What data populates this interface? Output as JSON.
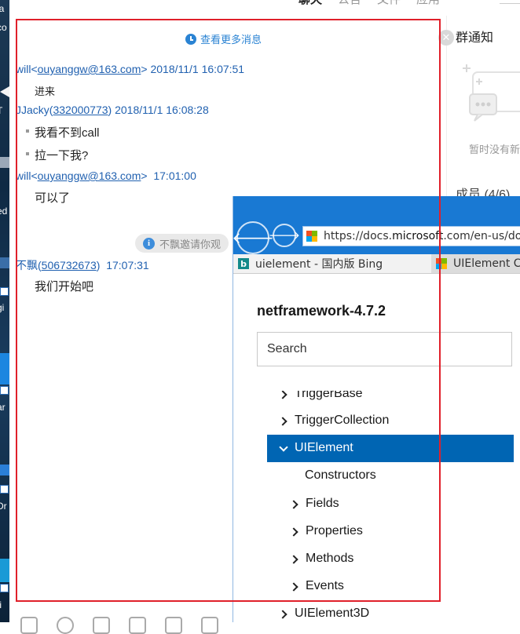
{
  "top_tabs": [
    "聊天",
    "公告",
    "文件",
    "应用"
  ],
  "chat": {
    "more_messages": "查看更多消息",
    "messages": [
      {
        "sender": "will",
        "contact": "ouyanggw@163.com",
        "time": "2018/11/1 16:07:51",
        "lines": [
          "进来"
        ]
      },
      {
        "sender": "JJacky",
        "contact": "332000773",
        "time": "2018/11/1 16:08:28",
        "lines": [
          "我看不到call",
          "拉一下我?"
        ]
      },
      {
        "sender": "will",
        "contact": "ouyanggw@163.com",
        "time": "17:01:00",
        "lines": [
          "可以了"
        ]
      },
      {
        "sender": "不飘",
        "contact": "506732673",
        "time": "17:07:31",
        "lines": [
          "我们开始吧"
        ]
      }
    ],
    "system_notice": "不飘邀请你观"
  },
  "right_panel": {
    "title": "群通知",
    "empty_text": "暂时没有新",
    "members": "成员 (4/6)"
  },
  "browser": {
    "url_prefix": "https://docs.",
    "url_domain": "microsoft",
    "url_suffix": ".com/en-us/do",
    "tabs": [
      "uielement - 国内版 Bing",
      "UIElement C"
    ],
    "doc_title": "netframework-4.7.2",
    "search_placeholder": "Search",
    "toc": [
      {
        "label": "TriggerBase",
        "expanded": false,
        "selected": false
      },
      {
        "label": "TriggerCollection",
        "expanded": false,
        "selected": false
      },
      {
        "label": "UIElement",
        "expanded": true,
        "selected": true
      },
      {
        "label": "Constructors",
        "expanded": null,
        "selected": false
      },
      {
        "label": "Fields",
        "expanded": false,
        "selected": false
      },
      {
        "label": "Properties",
        "expanded": false,
        "selected": false
      },
      {
        "label": "Methods",
        "expanded": false,
        "selected": false
      },
      {
        "label": "Events",
        "expanded": false,
        "selected": false
      },
      {
        "label": "UIElement3D",
        "expanded": false,
        "selected": false
      }
    ]
  },
  "desktop_strip": [
    "ia",
    "co",
    "T",
    "ed",
    "gi",
    "I",
    "ar",
    "Dr",
    "ti"
  ],
  "colors": {
    "link": "#2161b0",
    "accent": "#2a83d3",
    "browser_blue": "#1979d3",
    "toc_selected": "#0065b3",
    "annotation": "#e0202a"
  }
}
